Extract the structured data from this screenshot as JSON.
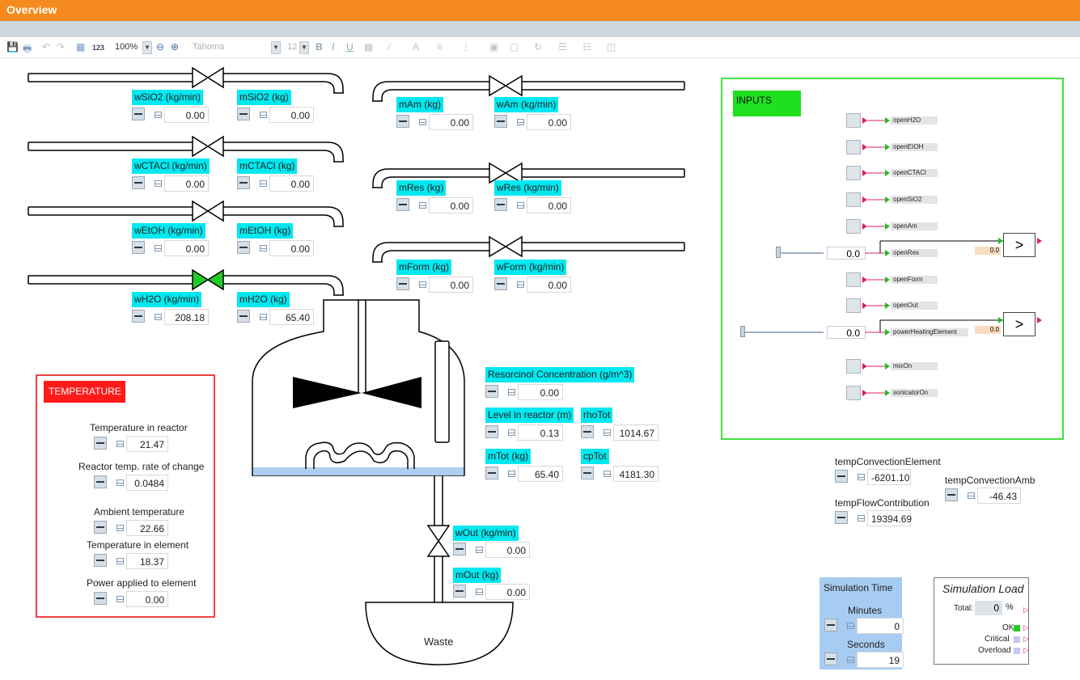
{
  "window": {
    "title": "Overview"
  },
  "toolbar": {
    "zoom": "100%",
    "font": "Tahoma",
    "font_size": "12",
    "bold": "B",
    "italic": "I",
    "underline": "U",
    "numfmt": "123"
  },
  "valves_left": [
    {
      "w_label": "wSiO2 (kg/min)",
      "w_value": "0.00",
      "m_label": "mSiO2 (kg)",
      "m_value": "0.00",
      "open": false
    },
    {
      "w_label": "wCTACl (kg/min)",
      "w_value": "0.00",
      "m_label": "mCTACl (kg)",
      "m_value": "0.00",
      "open": false
    },
    {
      "w_label": "wEtOH (kg/min)",
      "w_value": "0.00",
      "m_label": "mEtOH (kg)",
      "m_value": "0.00",
      "open": false
    },
    {
      "w_label": "wH2O (kg/min)",
      "w_value": "208.18",
      "m_label": "mH2O (kg)",
      "m_value": "65.40",
      "open": true
    }
  ],
  "valves_right": [
    {
      "m_label": "mAm (kg)",
      "m_value": "0.00",
      "w_label": "wAm (kg/min)",
      "w_value": "0.00",
      "open": false
    },
    {
      "m_label": "mRes (kg)",
      "m_value": "0.00",
      "w_label": "wRes (kg/min)",
      "w_value": "0.00",
      "open": false
    },
    {
      "m_label": "mForm (kg)",
      "m_value": "0.00",
      "w_label": "wForm (kg/min)",
      "w_value": "0.00",
      "open": false
    }
  ],
  "reactor": {
    "resorcinol_label": "Resorcinol Concentration (g/m^3)",
    "resorcinol_value": "0.00",
    "level_label": "Level in reactor (m)",
    "level_value": "0.13",
    "rhotot_label": "rhoTot",
    "rhotot_value": "1014.67",
    "mtot_label": "mTot (kg)",
    "mtot_value": "65.40",
    "cptot_label": "cpTot",
    "cptot_value": "4181.30"
  },
  "outlet": {
    "wout_label": "wOut (kg/min)",
    "wout_value": "0.00",
    "mout_label": "mOut (kg)",
    "mout_value": "0.00",
    "waste_label": "Waste"
  },
  "temperature": {
    "header": "TEMPERATURE",
    "items": [
      {
        "label": "Temperature in reactor",
        "value": "21.47"
      },
      {
        "label": "Reactor temp. rate of change",
        "value": "0.0484"
      },
      {
        "label": "Ambient temperature",
        "value": "22.66"
      },
      {
        "label": "Temperature in element",
        "value": "18.37"
      },
      {
        "label": "Power applied to element",
        "value": "0.00"
      }
    ]
  },
  "inputs": {
    "header": "INPUTS",
    "items": [
      "openH2O",
      "openEtOH",
      "openCTACl",
      "openSiO2",
      "openAm",
      "openRes",
      "openForm",
      "openOut",
      "powerHeatingElement",
      "mixOn",
      "sonicatorOn"
    ],
    "openres_value": "0.0",
    "power_value": "0.0",
    "cmp1_threshold": "0.0",
    "cmp2_threshold": "0.0",
    "cmp_symbol": ">"
  },
  "temps_right": {
    "conv_elem_label": "tempConvectionElement",
    "conv_elem_value": "-6201.10",
    "flow_label": "tempFlowContribution",
    "flow_value": "19394.69",
    "conv_amb_label": "tempConvectionAmb",
    "conv_amb_value": "-46.43"
  },
  "simtime": {
    "title": "Simulation Time",
    "minutes_label": "Minutes",
    "minutes_value": "0",
    "seconds_label": "Seconds",
    "seconds_value": "19"
  },
  "simload": {
    "title": "Simulation Load",
    "total_label": "Total:",
    "total_value": "0",
    "percent": "%",
    "ok": "OK",
    "critical": "Critical",
    "overload": "Overload"
  },
  "colors": {
    "title": "#f58b1f",
    "cyan": "#00e8f0",
    "temp_red": "#ff1a1a",
    "inputs_green": "#1fe01f",
    "valve_open": "#22cc22"
  }
}
